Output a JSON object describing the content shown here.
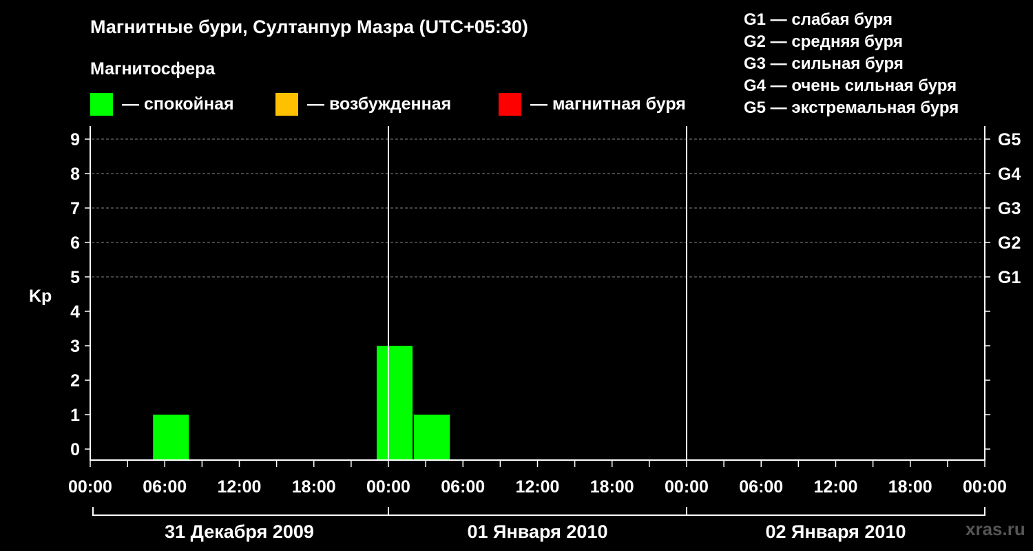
{
  "title": "Магнитные бури, Султанпур Мазра (UTC+05:30)",
  "subtitle": "Магнитосфера",
  "legend": [
    {
      "color": "#00ff00",
      "label": "— спокойная"
    },
    {
      "color": "#ffc000",
      "label": "— возбужденная"
    },
    {
      "color": "#ff0000",
      "label": "— магнитная буря"
    }
  ],
  "storm_levels": [
    "G1 — слабая буря",
    "G2 — средняя буря",
    "G3 — сильная буря",
    "G4 — очень сильная буря",
    "G5 — экстремальная буря"
  ],
  "watermark": "xras.ru",
  "colors": {
    "background": "#000000",
    "calm": "#00ff00",
    "disturbed": "#ffc000",
    "storm": "#ff0000",
    "axis": "#ffffff",
    "grid": "#888888",
    "watermark": "#555555"
  },
  "chart_data": {
    "type": "bar",
    "ylabel": "Kp",
    "ylim": [
      0,
      9
    ],
    "y_ticks": [
      0,
      1,
      2,
      3,
      4,
      5,
      6,
      7,
      8,
      9
    ],
    "right_axis_labels": [
      {
        "kp": 5,
        "label": "G1"
      },
      {
        "kp": 6,
        "label": "G2"
      },
      {
        "kp": 7,
        "label": "G3"
      },
      {
        "kp": 8,
        "label": "G4"
      },
      {
        "kp": 9,
        "label": "G5"
      }
    ],
    "grid": "dashed horizontal lines at Kp 5–9",
    "x_range_hours": [
      0,
      72
    ],
    "x_tick_labels": [
      "00:00",
      "06:00",
      "12:00",
      "18:00",
      "00:00",
      "06:00",
      "12:00",
      "18:00",
      "00:00",
      "06:00",
      "12:00",
      "18:00",
      "00:00"
    ],
    "x_tick_label_step_hours": 6,
    "minor_tick_step_hours": 3,
    "day_dividers_hours": [
      24,
      48
    ],
    "days": [
      "31 Декабря 2009",
      "01 Января 2010",
      "02 Января 2010"
    ],
    "bar_width_hours": 3,
    "bars": [
      {
        "start_hour": 5,
        "kp": 1,
        "level": "calm"
      },
      {
        "start_hour": 23,
        "kp": 3,
        "level": "calm"
      },
      {
        "start_hour": 26,
        "kp": 1,
        "level": "calm"
      }
    ]
  }
}
